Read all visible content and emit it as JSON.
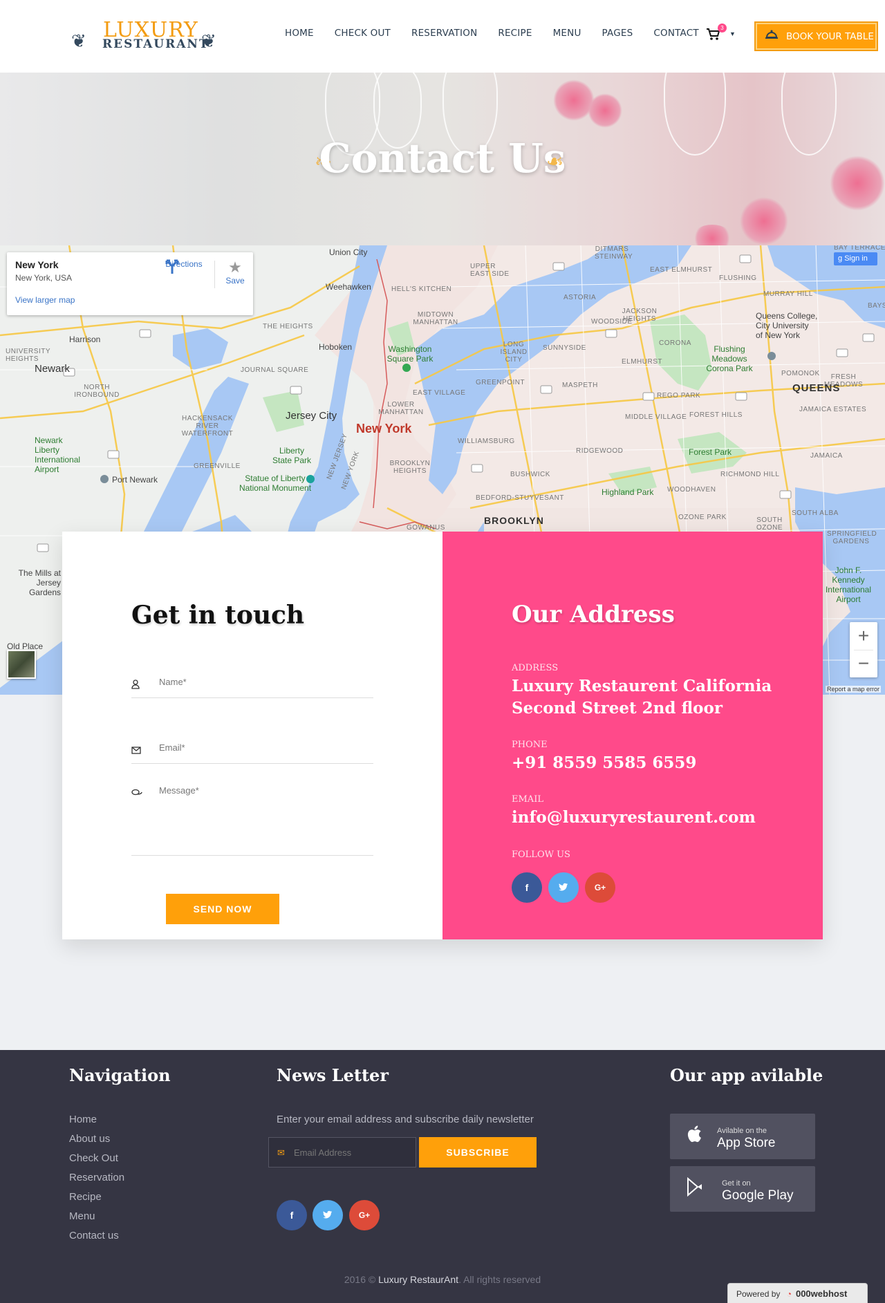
{
  "brand": {
    "line1": "LUXURY",
    "line2": "RESTAURANT"
  },
  "nav": [
    "HOME",
    "CHECK OUT",
    "RESERVATION",
    "RECIPE",
    "MENU",
    "PAGES",
    "CONTACT"
  ],
  "cart": {
    "count": "3"
  },
  "book_button": "BOOK YOUR TABLE",
  "hero": {
    "title": "Contact Us"
  },
  "map": {
    "card": {
      "title": "New York",
      "subtitle": "New York, USA",
      "directions": "Directions",
      "save": "Save",
      "larger": "View larger map"
    },
    "sign_in": "Sign in",
    "report": "Report a map error",
    "labels": {
      "union_city": "Union City",
      "weehawken": "Weehawken",
      "hells_kitchen": "HELL'S KITCHEN",
      "midtown": "MIDTOWN MANHATTAN",
      "harrison": "Harrison",
      "newark": "Newark",
      "hoboken": "Hoboken",
      "washington_sq": "Washington Square Park",
      "jersey_city": "Jersey City",
      "new_york": "New York",
      "liberty": "Liberty State Park",
      "statue": "Statue of Liberty National Monument",
      "port_newark": "Port Newark",
      "brooklyn": "BROOKLYN",
      "queens": "QUEENS",
      "long_island_city": "LONG ISLAND CITY",
      "woodside": "WOODSIDE",
      "jackson_heights": "JACKSON HEIGHTS",
      "corona": "CORONA",
      "flushing_meadows": "Flushing Meadows Corona Park",
      "queens_college": "Queens College, City University of New York",
      "forest_park": "Forest Park",
      "highland_park": "Highland Park",
      "williamsburg": "WILLIAMSBURG",
      "bushwick": "BUSHWICK",
      "bedford": "BEDFORD-STUYVESANT",
      "ridgewood": "RIDGEWOOD",
      "jfk": "John F. Kennedy International Airport",
      "newark_airport": "Newark Liberty International Airport",
      "east_elmhurst": "EAST ELMHURST",
      "flushing": "FLUSHING",
      "murray_hill": "MURRAY HILL",
      "jamaica": "JAMAICA",
      "the_mills": "The Mills at Jersey Gardens",
      "astoria": "ASTORIA",
      "east_village": "EAST VILLAGE",
      "greenpoint": "GREENPOINT",
      "elmhurst": "ELMHURST",
      "maspeth": "MASPETH",
      "rego_park": "REGO PARK",
      "forest_hills": "FOREST HILLS",
      "middle_village": "MIDDLE VILLAGE",
      "richmond_hill": "RICHMOND HILL",
      "woodhaven": "WOODHAVEN",
      "ozone_park": "OZONE PARK",
      "jamaica_estates": "JAMAICA ESTATES",
      "pomonok": "POMONOK",
      "fresh_meadows": "FRESH MEADOWS",
      "heights": "THE HEIGHTS",
      "journal_square": "JOURNAL SQUARE",
      "north_ironbound": "NORTH IRONBOUND",
      "hackensack": "HACKENSACK RIVER WATERFRONT",
      "greenville": "GREENVILLE",
      "lower_manhattan": "LOWER MANHATTAN",
      "upper_east_side": "UPPER EAST SIDE",
      "ditmars": "DITMARS STEINWAY",
      "sunnyside": "SUNNYSIDE",
      "bay_terrace": "BAY TERRACE",
      "south_ozone": "SOUTH OZONE PARK",
      "springfield": "SPRINGFIELD GARDENS",
      "south_albany": "SOUTH ALBA",
      "old_place": "Old Place",
      "university_heights": "UNIVERSITY HEIGHTS",
      "gowanus": "GOWANUS",
      "brooklyn_heights": "BROOKLYN HEIGHTS",
      "bayside": "BAYSID",
      "new_jersey": "NEW JERSEY",
      "new_york_road": "NEW YORK"
    }
  },
  "contact_form": {
    "heading": "Get in touch",
    "name_placeholder": "Name*",
    "email_placeholder": "Email*",
    "message_placeholder": "Message*",
    "send_button": "SEND NOW"
  },
  "address": {
    "heading": "Our Address",
    "address_label": "ADDRESS",
    "address_line1": "Luxury Restaurent California",
    "address_line2": "Second Street 2nd floor",
    "phone_label": "PHONE",
    "phone": "+91 8559 5585 6559",
    "email_label": "EMAIL",
    "email": "info@luxuryrestaurent.com",
    "follow_label": "FOLLOW US"
  },
  "social": {
    "facebook": "f",
    "twitter": "t",
    "google": "G+"
  },
  "colors": {
    "accent": "#ffa00a",
    "pink": "#ff4a8a",
    "facebook": "#3b5998",
    "twitter": "#55acee",
    "google": "#dd4b39",
    "footer": "#353543"
  },
  "footer": {
    "navigation_heading": "Navigation",
    "navigation_items": [
      "Home",
      "About us",
      "Check Out",
      "Reservation",
      "Recipe",
      "Menu",
      "Contact us"
    ],
    "newsletter_heading": "News Letter",
    "newsletter_text": "Enter your email address and subscribe daily newsletter",
    "email_placeholder": "Email Address",
    "subscribe": "SUBSCRIBE",
    "app_heading": "Our app avilable",
    "app_store_small": "Avilable on the",
    "app_store_big": "App Store",
    "play_small": "Get it on",
    "play_big": "Google Play",
    "copyright_year": "2016 ©",
    "copyright_brand": "Luxury RestaurAnt",
    "copyright_rest": ". All rights reserved"
  },
  "powered": {
    "label": "Powered by",
    "host": "000webhost"
  }
}
